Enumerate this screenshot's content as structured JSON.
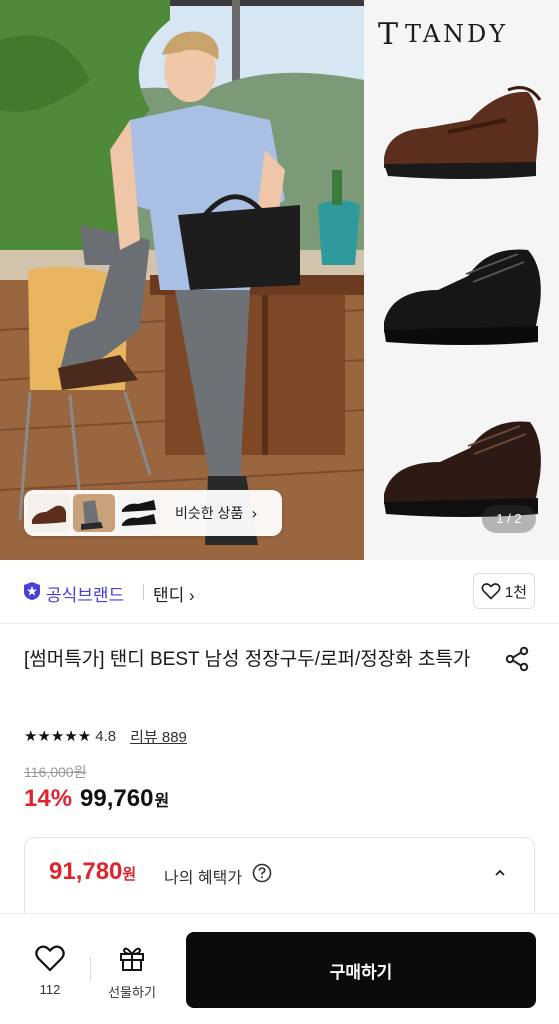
{
  "hero": {
    "brand_logo": "TANDY",
    "brand_logo_mark": "T",
    "similar_label": "비슷한 상품",
    "page_indicator": "1 / 2",
    "shoes": [
      "brown-penny-loafer",
      "black-derby",
      "dark-brown-derby"
    ]
  },
  "brand": {
    "official_label": "공식브랜드",
    "name": "탠디 ›",
    "like_count": "1천"
  },
  "product": {
    "title": "[썸머특가] 탠디 BEST 남성 정장구두/로퍼/정장화 초특가",
    "stars": "★★★★★",
    "rating": "4.8",
    "review": "리뷰 889",
    "original_price": "116,000원",
    "discount": "14%",
    "sale_price": "99,760",
    "won": "원"
  },
  "benefit": {
    "price": "91,780",
    "won": "원",
    "label": "나의 혜택가"
  },
  "bottom_bar": {
    "wish_count": "112",
    "gift_label": "선물하기",
    "buy_label": "구매하기"
  },
  "colors": {
    "accent_red": "#e0242f",
    "official_purple": "#4a3fd8",
    "buy_button": "#0b0b0b"
  }
}
